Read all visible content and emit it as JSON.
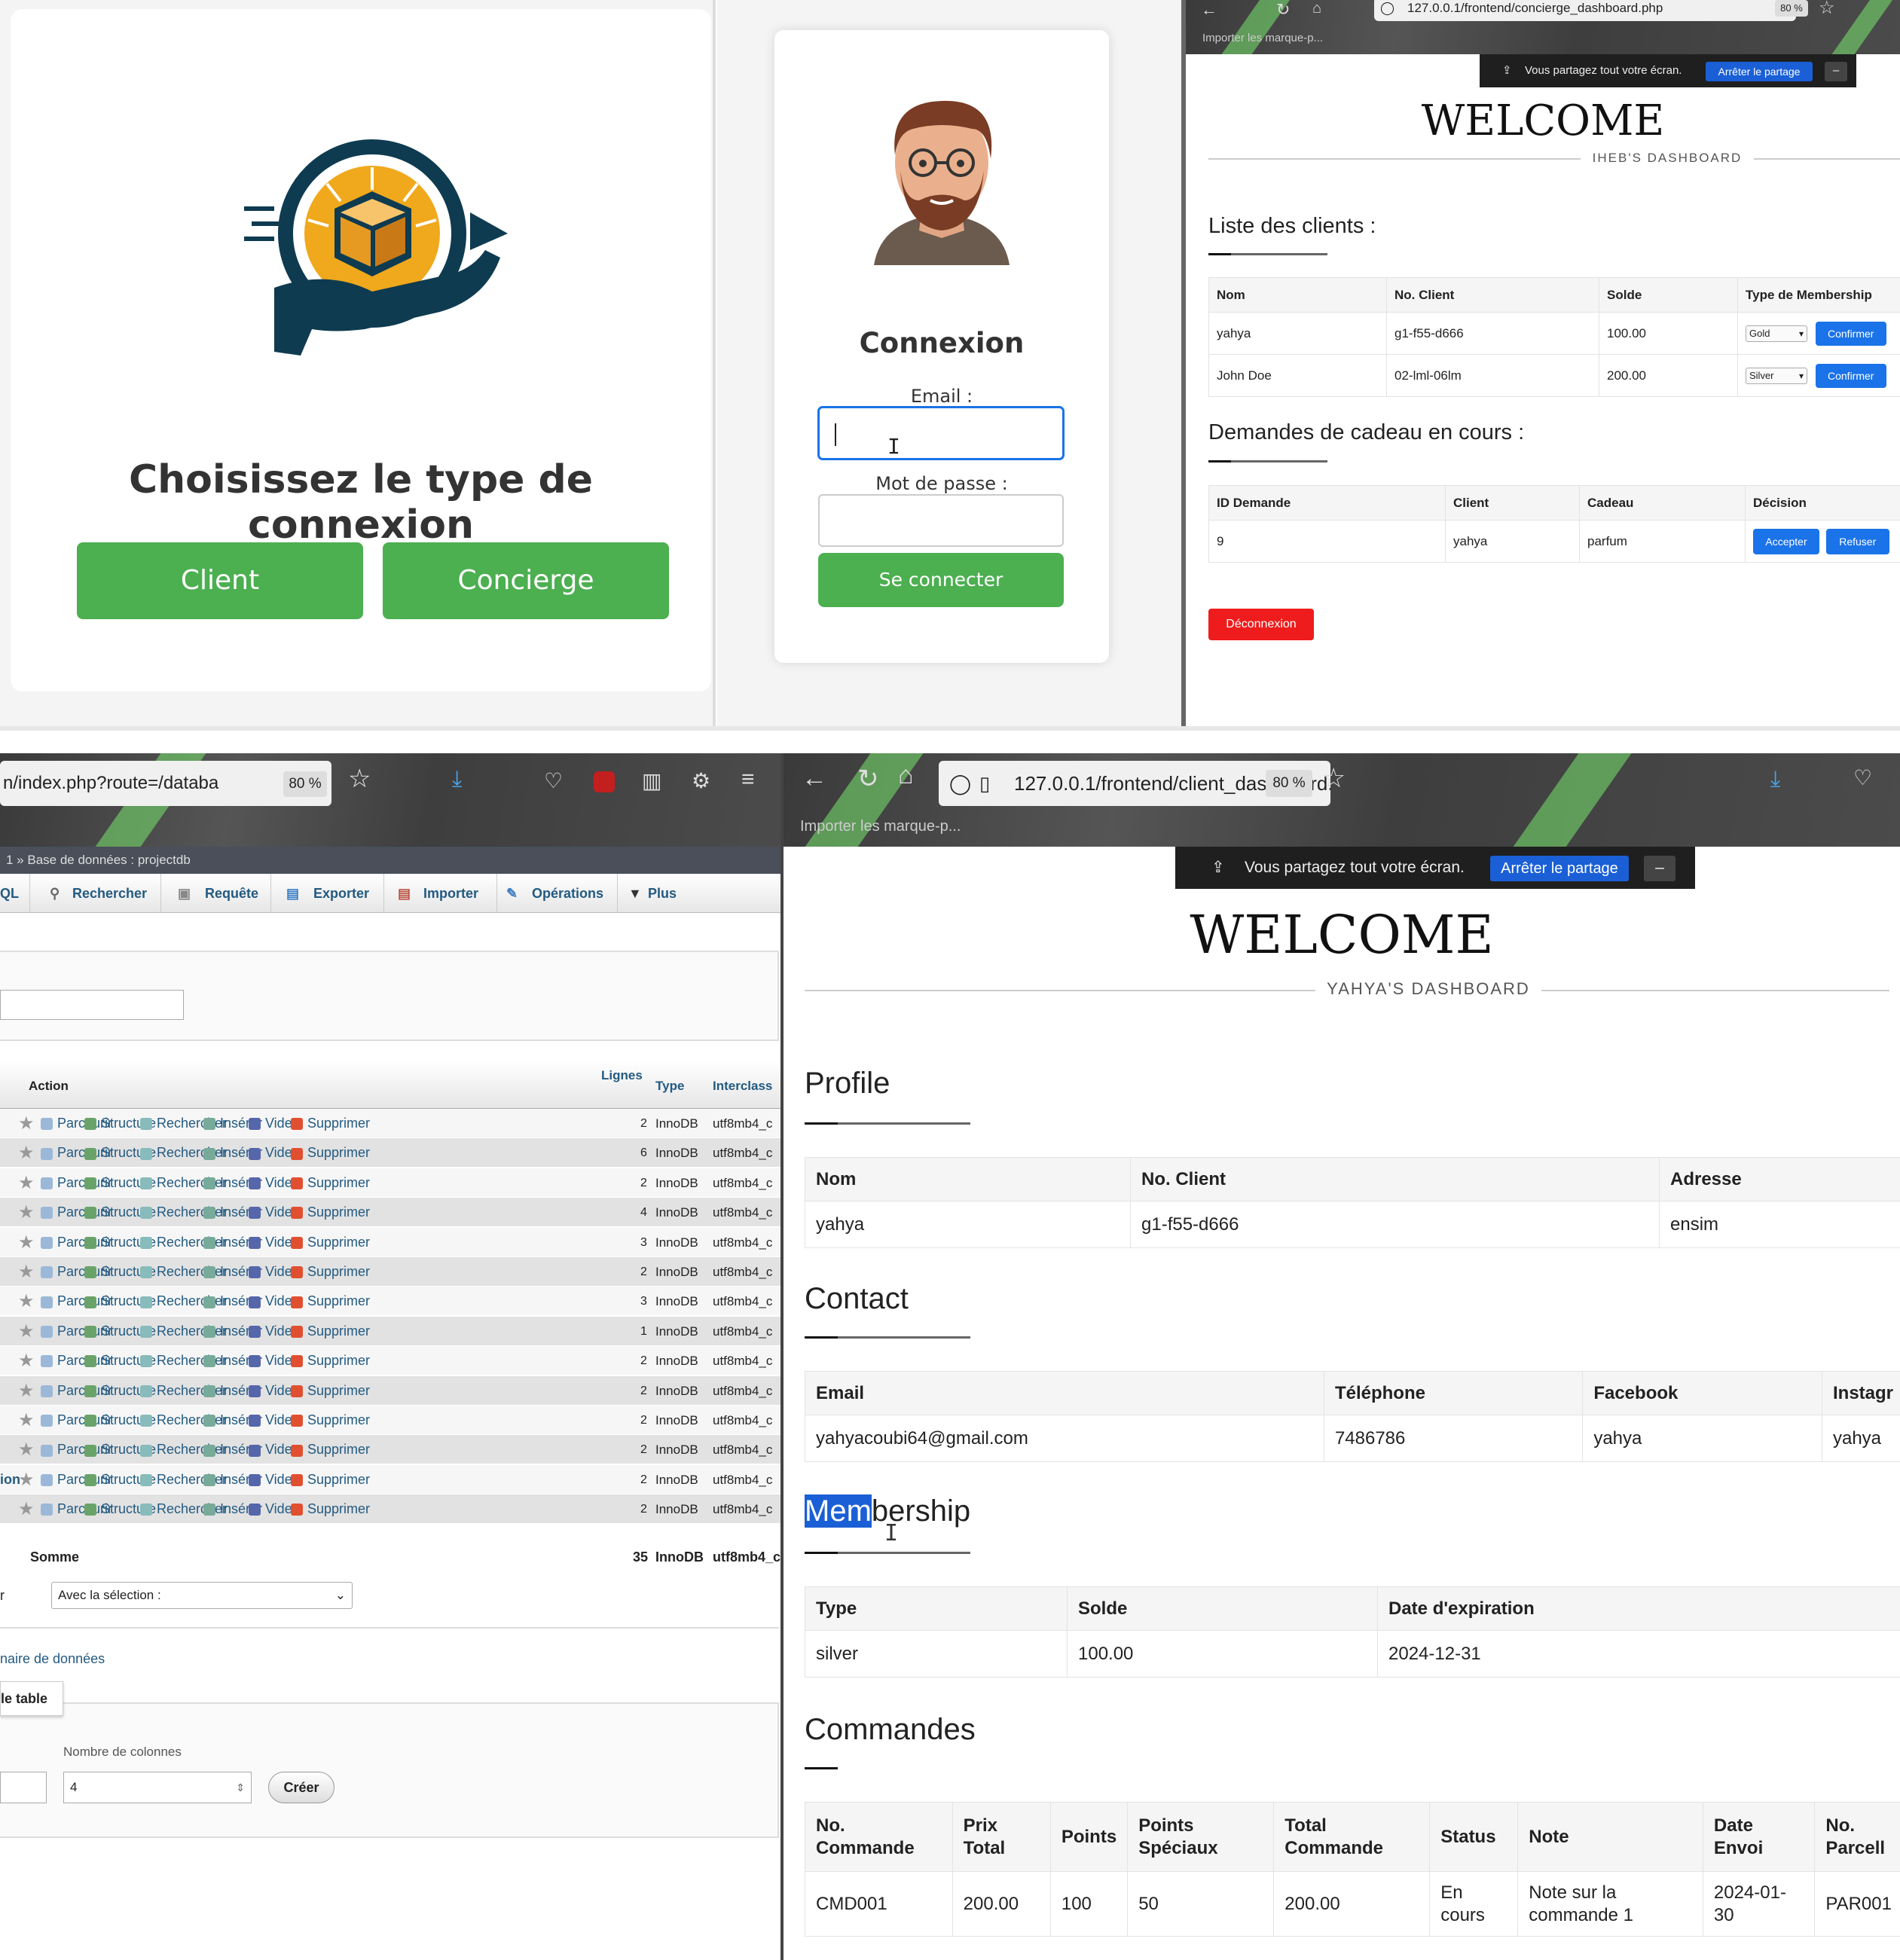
{
  "connexion": {
    "title": "Choisissez le type de connexion",
    "client_btn": "Client",
    "concierge_btn": "Concierge"
  },
  "login": {
    "heading": "Connexion",
    "email_label": "Email :",
    "password_label": "Mot de passe :",
    "submit": "Se connecter"
  },
  "concierge": {
    "url": "127.0.0.1/frontend/concierge_dashboard.php",
    "zoom": "80 %",
    "bookmark": "Importer les marque-p...",
    "share_text": "Vous partagez tout votre écran.",
    "share_stop": "Arrêter le partage",
    "welcome": "WELCOME",
    "subtitle": "IHEB'S DASHBOARD",
    "clients_title": "Liste des clients :",
    "clients_headers": [
      "Nom",
      "No. Client",
      "Solde",
      "Type de Membership"
    ],
    "clients": [
      {
        "nom": "yahya",
        "no": "g1-f55-d666",
        "solde": "100.00",
        "type": "Gold",
        "action": "Confirmer"
      },
      {
        "nom": "John Doe",
        "no": "02-lml-06lm",
        "solde": "200.00",
        "type": "Silver",
        "action": "Confirmer"
      }
    ],
    "gifts_title": "Demandes de cadeau en cours :",
    "gifts_headers": [
      "ID Demande",
      "Client",
      "Cadeau",
      "Décision"
    ],
    "gifts": [
      {
        "id": "9",
        "client": "yahya",
        "cadeau": "parfum",
        "accept": "Accepter",
        "refuse": "Refuser"
      }
    ],
    "logout": "Déconnexion",
    "colors": {
      "logout": "#ee1c1c",
      "button": "#1a73e8"
    }
  },
  "pma": {
    "url": "n/index.php?route=/databa",
    "zoom": "80 %",
    "breadcrumb": "1 » Base de données : projectdb",
    "tabs": [
      "QL",
      "Rechercher",
      "Requête",
      "Exporter",
      "Importer",
      "Opérations",
      "Plus"
    ],
    "headers": {
      "action": "Action",
      "lignes": "Lignes",
      "type": "Type",
      "interclass": "Interclass"
    },
    "actions": [
      "Parcourir",
      "Structure",
      "Rechercher",
      "Insérer",
      "Vider",
      "Supprimer"
    ],
    "rows": [
      {
        "prefix": "",
        "lignes": "2",
        "type": "InnoDB",
        "coll": "utf8mb4_c"
      },
      {
        "prefix": "",
        "lignes": "6",
        "type": "InnoDB",
        "coll": "utf8mb4_c"
      },
      {
        "prefix": "",
        "lignes": "2",
        "type": "InnoDB",
        "coll": "utf8mb4_c"
      },
      {
        "prefix": "",
        "lignes": "4",
        "type": "InnoDB",
        "coll": "utf8mb4_c"
      },
      {
        "prefix": "",
        "lignes": "3",
        "type": "InnoDB",
        "coll": "utf8mb4_c"
      },
      {
        "prefix": "",
        "lignes": "2",
        "type": "InnoDB",
        "coll": "utf8mb4_c"
      },
      {
        "prefix": "",
        "lignes": "3",
        "type": "InnoDB",
        "coll": "utf8mb4_c"
      },
      {
        "prefix": "",
        "lignes": "1",
        "type": "InnoDB",
        "coll": "utf8mb4_c"
      },
      {
        "prefix": "",
        "lignes": "2",
        "type": "InnoDB",
        "coll": "utf8mb4_c"
      },
      {
        "prefix": "",
        "lignes": "2",
        "type": "InnoDB",
        "coll": "utf8mb4_c"
      },
      {
        "prefix": "",
        "lignes": "2",
        "type": "InnoDB",
        "coll": "utf8mb4_c"
      },
      {
        "prefix": "",
        "lignes": "2",
        "type": "InnoDB",
        "coll": "utf8mb4_c"
      },
      {
        "prefix": "ion",
        "lignes": "2",
        "type": "InnoDB",
        "coll": "utf8mb4_c"
      },
      {
        "prefix": "",
        "lignes": "2",
        "type": "InnoDB",
        "coll": "utf8mb4_c"
      }
    ],
    "sum": {
      "label": "Somme",
      "lignes": "35",
      "type": "InnoDB",
      "coll": "utf8mb4_c"
    },
    "with_selection": "Avec la sélection :",
    "r_label": "r",
    "dict_link": "naire de données",
    "new_table_tab": "le table",
    "ncols_label": "Nombre de colonnes",
    "ncols_value": "4",
    "create": "Créer"
  },
  "client": {
    "url": "127.0.0.1/frontend/client_dashboard.php",
    "zoom": "80 %",
    "bookmark": "Importer les marque-p...",
    "share_text": "Vous partagez tout votre écran.",
    "share_stop": "Arrêter le partage",
    "welcome": "WELCOME",
    "subtitle": "YAHYA'S DASHBOARD",
    "profile": {
      "title": "Profile",
      "headers": [
        "Nom",
        "No. Client",
        "Adresse"
      ],
      "row": [
        "yahya",
        "g1-f55-d666",
        "ensim"
      ]
    },
    "contact": {
      "title": "Contact",
      "headers": [
        "Email",
        "Téléphone",
        "Facebook",
        "Instagr"
      ],
      "row": [
        "yahyacoubi64@gmail.com",
        "7486786",
        "yahya",
        "yahya"
      ]
    },
    "membership": {
      "title_highlight": "Mem",
      "title_rest": "bership",
      "headers": [
        "Type",
        "Solde",
        "Date d'expiration"
      ],
      "row": [
        "silver",
        "100.00",
        "2024-12-31"
      ]
    },
    "commandes": {
      "title": "Commandes",
      "headers": [
        [
          "No.",
          "Commande"
        ],
        [
          "Prix",
          "Total"
        ],
        [
          "Points",
          ""
        ],
        [
          "Points",
          "Spéciaux"
        ],
        [
          "Total",
          "Commande"
        ],
        [
          "Status",
          ""
        ],
        [
          "Note",
          ""
        ],
        [
          "Date",
          "Envoi"
        ],
        [
          "No.",
          "Parcell"
        ]
      ],
      "row": [
        [
          "CMD001",
          ""
        ],
        [
          "200.00",
          ""
        ],
        [
          "100",
          ""
        ],
        [
          "50",
          ""
        ],
        [
          "200.00",
          ""
        ],
        [
          "En",
          "cours"
        ],
        [
          "Note sur la",
          "commande 1"
        ],
        [
          "2024-01-30",
          ""
        ],
        [
          "PAR001",
          ""
        ]
      ]
    }
  }
}
